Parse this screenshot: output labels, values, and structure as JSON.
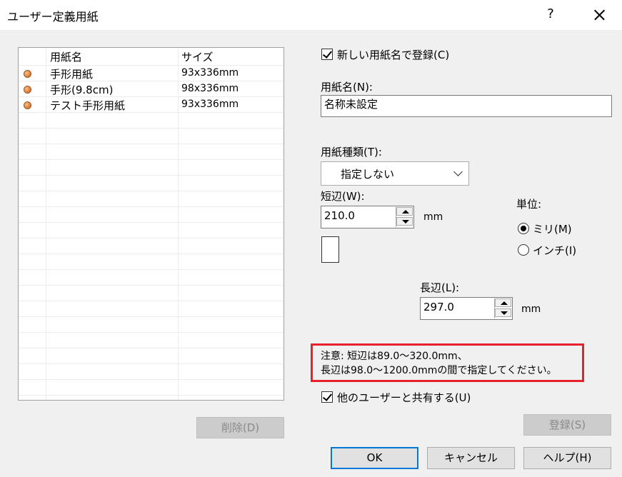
{
  "window": {
    "title": "ユーザー定義用紙",
    "help": "?"
  },
  "list": {
    "columns": [
      "用紙名",
      "サイズ"
    ],
    "rows": [
      {
        "name": "手形用紙",
        "size": "93x336mm"
      },
      {
        "name": "手形(9.8cm)",
        "size": "98x336mm"
      },
      {
        "name": "テスト手形用紙",
        "size": "93x336mm"
      }
    ]
  },
  "delete_button": "削除(D)",
  "new_name_check": {
    "label": "新しい用紙名で登録(C)",
    "checked": true
  },
  "paper_name": {
    "label": "用紙名(N):",
    "value": "名称未設定"
  },
  "paper_type": {
    "label": "用紙種類(T):",
    "value": "指定しない"
  },
  "short_edge": {
    "label": "短辺(W):",
    "value": "210.0",
    "unit": "mm"
  },
  "long_edge": {
    "label": "長辺(L):",
    "value": "297.0",
    "unit": "mm"
  },
  "unit_group": {
    "label": "単位:",
    "options": [
      {
        "label": "ミリ(M)",
        "selected": true
      },
      {
        "label": "インチ(I)",
        "selected": false
      }
    ]
  },
  "notice": {
    "line1": "注意: 短辺は89.0～320.0mm、",
    "line2": "長辺は98.0～1200.0mmの間で指定してください。",
    "highlight_color": "#e8202a"
  },
  "share_check": {
    "label": "他のユーザーと共有する(U)",
    "checked": true
  },
  "register_button": "登録(S)",
  "ok_button": "OK",
  "cancel_button": "キャンセル",
  "help_button": "ヘルプ(H)"
}
